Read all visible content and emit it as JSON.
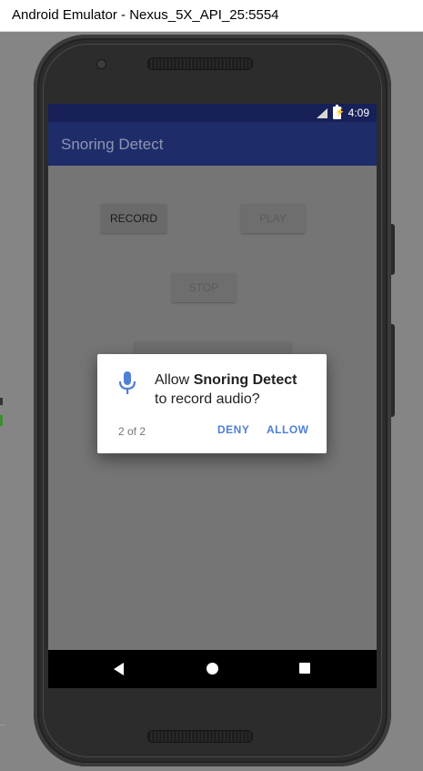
{
  "window": {
    "title": "Android Emulator - Nexus_5X_API_25:5554"
  },
  "device": {
    "model_icons": [
      "camera-icon",
      "speaker-icon"
    ]
  },
  "status_bar": {
    "time": "4:09",
    "icons": [
      "signal-icon",
      "battery-charging-icon"
    ],
    "color": "#172057"
  },
  "app": {
    "title": "Snoring Detect",
    "bar_color": "#1e2c6a",
    "buttons": {
      "record": "RECORD",
      "play": "PLAY",
      "stop": "STOP"
    }
  },
  "dialog": {
    "icon": "microphone-icon",
    "message_prefix": "Allow ",
    "app_name": "Snoring Detect",
    "message_suffix": "to record audio?",
    "counter": "2 of 2",
    "deny_label": "DENY",
    "allow_label": "ALLOW",
    "accent_color": "#4f7fd6"
  },
  "nav_bar": {
    "icons": [
      "back-icon",
      "home-icon",
      "recents-icon"
    ]
  }
}
